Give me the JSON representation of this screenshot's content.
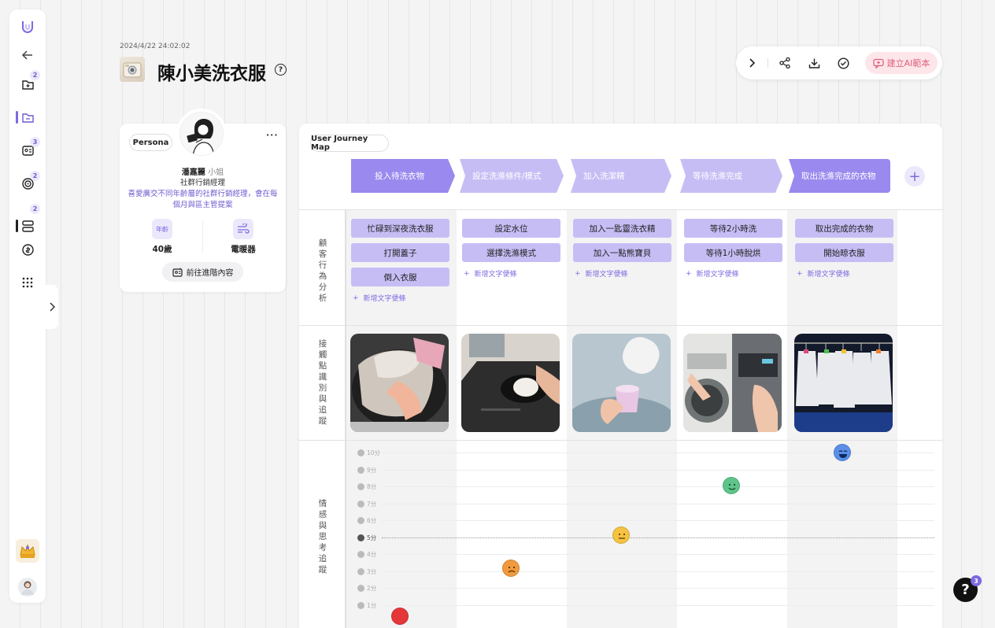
{
  "sidebar": {
    "badges": {
      "folder": "2",
      "contacts": "3",
      "target": "2",
      "board": "2"
    }
  },
  "header": {
    "timestamp": "2024/4/22 24:02:02",
    "title": "陳小美洗衣服",
    "help_glyph": "?"
  },
  "toolbar": {
    "ai_template_label": "建立AI範本"
  },
  "persona": {
    "tag": "Persona",
    "more": "···",
    "name": "潘嘉麗",
    "honorific": "小姐",
    "role": "社群行銷經理",
    "description": "喜愛廣交不同年齡層的社群行銷經理，會在每個月與區主管提案",
    "age_icon_label": "年齡",
    "age": "40歲",
    "appliance": "電暖器",
    "advanced_button": "前往進階內容"
  },
  "journey": {
    "tag": "User Journey Map",
    "stages": [
      "投入待洗衣物",
      "設定洗滌條件/模式",
      "加入洗潔精",
      "等待洗滌完成",
      "取出洗滌完成的衣物"
    ],
    "rows": {
      "behavior_label": "顧客行為分析",
      "touchpoint_label": "接觸點識別與追蹤",
      "emotion_label": "情感與思考追蹤"
    },
    "notes": [
      [
        "忙碌到深夜洗衣服",
        "打開蓋子",
        "倒入衣服"
      ],
      [
        "設定水位",
        "選擇洗滌模式"
      ],
      [
        "加入一匙靈洗衣精",
        "加入一點熊寶貝"
      ],
      [
        "等待2小時洗",
        "等待1小時脫烘"
      ],
      [
        "取出完成的衣物",
        "開始晾衣服"
      ]
    ],
    "add_note_label": "新增文字便條",
    "score_labels": [
      "10分",
      "9分",
      "8分",
      "7分",
      "6分",
      "5分",
      "4分",
      "3分",
      "2分",
      "1分"
    ],
    "emotion_scores": [
      1,
      3,
      5,
      8,
      10
    ],
    "emotion_colors": {
      "1": "#e5373a",
      "3": "#f19a3e",
      "5": "#f5c242",
      "8": "#5fc48a",
      "10": "#5b8fe8"
    }
  },
  "help_fab": {
    "glyph": "?",
    "badge": "3"
  }
}
